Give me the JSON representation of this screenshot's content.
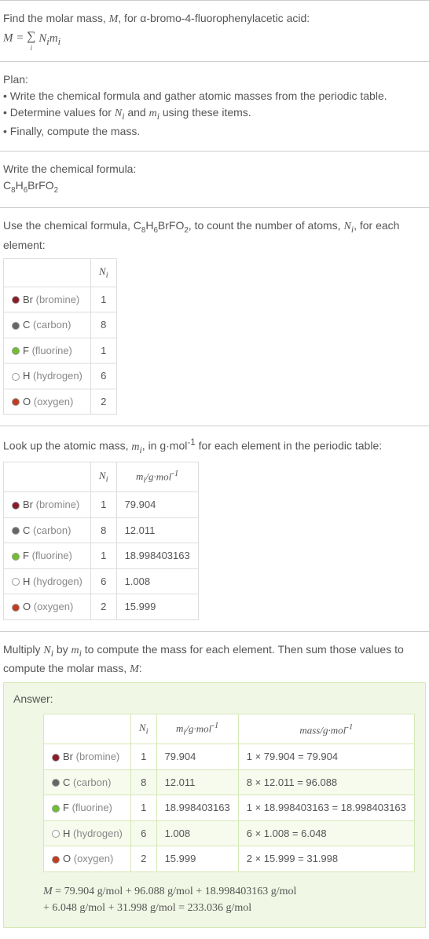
{
  "problem": {
    "intro": "Find the molar mass, ",
    "var_M": "M",
    "for": ", for α-bromo-4-fluorophenylacetic acid:",
    "formula_tex": "M = ∑ᵢ Nᵢ mᵢ"
  },
  "plan": {
    "title": "Plan:",
    "lines": [
      "• Write the chemical formula and gather atomic masses from the periodic table.",
      "• Determine values for Nᵢ and mᵢ using these items.",
      "• Finally, compute the mass."
    ]
  },
  "step_formula": {
    "title": "Write the chemical formula:",
    "formula_plain": "C8H6BrFO2"
  },
  "step_count": {
    "intro_a": "Use the chemical formula, ",
    "intro_b": ", to count the number of atoms, ",
    "intro_c": ", for each element:",
    "header_N": "Nᵢ",
    "rows": [
      {
        "color": "#8a1c28",
        "sym": "Br",
        "name": "(bromine)",
        "N": "1"
      },
      {
        "color": "#666666",
        "sym": "C",
        "name": "(carbon)",
        "N": "8"
      },
      {
        "color": "#6fbf2f",
        "sym": "F",
        "name": "(fluorine)",
        "N": "1"
      },
      {
        "color": "#ffffff",
        "sym": "H",
        "name": "(hydrogen)",
        "N": "6"
      },
      {
        "color": "#c23b22",
        "sym": "O",
        "name": "(oxygen)",
        "N": "2"
      }
    ]
  },
  "step_mass": {
    "intro_a": "Look up the atomic mass, ",
    "intro_b": ", in g·mol",
    "intro_c": " for each element in the periodic table:",
    "header_N": "Nᵢ",
    "header_m": "mᵢ/g·mol⁻¹",
    "rows": [
      {
        "color": "#8a1c28",
        "sym": "Br",
        "name": "(bromine)",
        "N": "1",
        "m": "79.904"
      },
      {
        "color": "#666666",
        "sym": "C",
        "name": "(carbon)",
        "N": "8",
        "m": "12.011"
      },
      {
        "color": "#6fbf2f",
        "sym": "F",
        "name": "(fluorine)",
        "N": "1",
        "m": "18.998403163"
      },
      {
        "color": "#ffffff",
        "sym": "H",
        "name": "(hydrogen)",
        "N": "6",
        "m": "1.008"
      },
      {
        "color": "#c23b22",
        "sym": "O",
        "name": "(oxygen)",
        "N": "2",
        "m": "15.999"
      }
    ]
  },
  "step_multiply": {
    "intro": "Multiply Nᵢ by mᵢ to compute the mass for each element. Then sum those values to compute the molar mass, M:"
  },
  "answer": {
    "label": "Answer:",
    "header_N": "Nᵢ",
    "header_m": "mᵢ/g·mol⁻¹",
    "header_mass": "mass/g·mol⁻¹",
    "rows": [
      {
        "color": "#8a1c28",
        "sym": "Br",
        "name": "(bromine)",
        "N": "1",
        "m": "79.904",
        "calc": "1 × 79.904 = 79.904"
      },
      {
        "color": "#666666",
        "sym": "C",
        "name": "(carbon)",
        "N": "8",
        "m": "12.011",
        "calc": "8 × 12.011 = 96.088"
      },
      {
        "color": "#6fbf2f",
        "sym": "F",
        "name": "(fluorine)",
        "N": "1",
        "m": "18.998403163",
        "calc": "1 × 18.998403163 = 18.998403163"
      },
      {
        "color": "#ffffff",
        "sym": "H",
        "name": "(hydrogen)",
        "N": "6",
        "m": "1.008",
        "calc": "6 × 1.008 = 6.048"
      },
      {
        "color": "#c23b22",
        "sym": "O",
        "name": "(oxygen)",
        "N": "2",
        "m": "15.999",
        "calc": "2 × 15.999 = 31.998"
      }
    ],
    "final_line1": "M = 79.904 g/mol + 96.088 g/mol + 18.998403163 g/mol",
    "final_line2": "+ 6.048 g/mol + 31.998 g/mol = 233.036 g/mol"
  },
  "chart_data": {
    "type": "table",
    "title": "Molar mass computation for C8H6BrFO2",
    "columns": [
      "element",
      "N_i",
      "m_i (g·mol⁻¹)",
      "mass (g·mol⁻¹)"
    ],
    "rows": [
      [
        "Br",
        1,
        79.904,
        79.904
      ],
      [
        "C",
        8,
        12.011,
        96.088
      ],
      [
        "F",
        1,
        18.998403163,
        18.998403163
      ],
      [
        "H",
        6,
        1.008,
        6.048
      ],
      [
        "O",
        2,
        15.999,
        31.998
      ]
    ],
    "total": 233.036
  }
}
